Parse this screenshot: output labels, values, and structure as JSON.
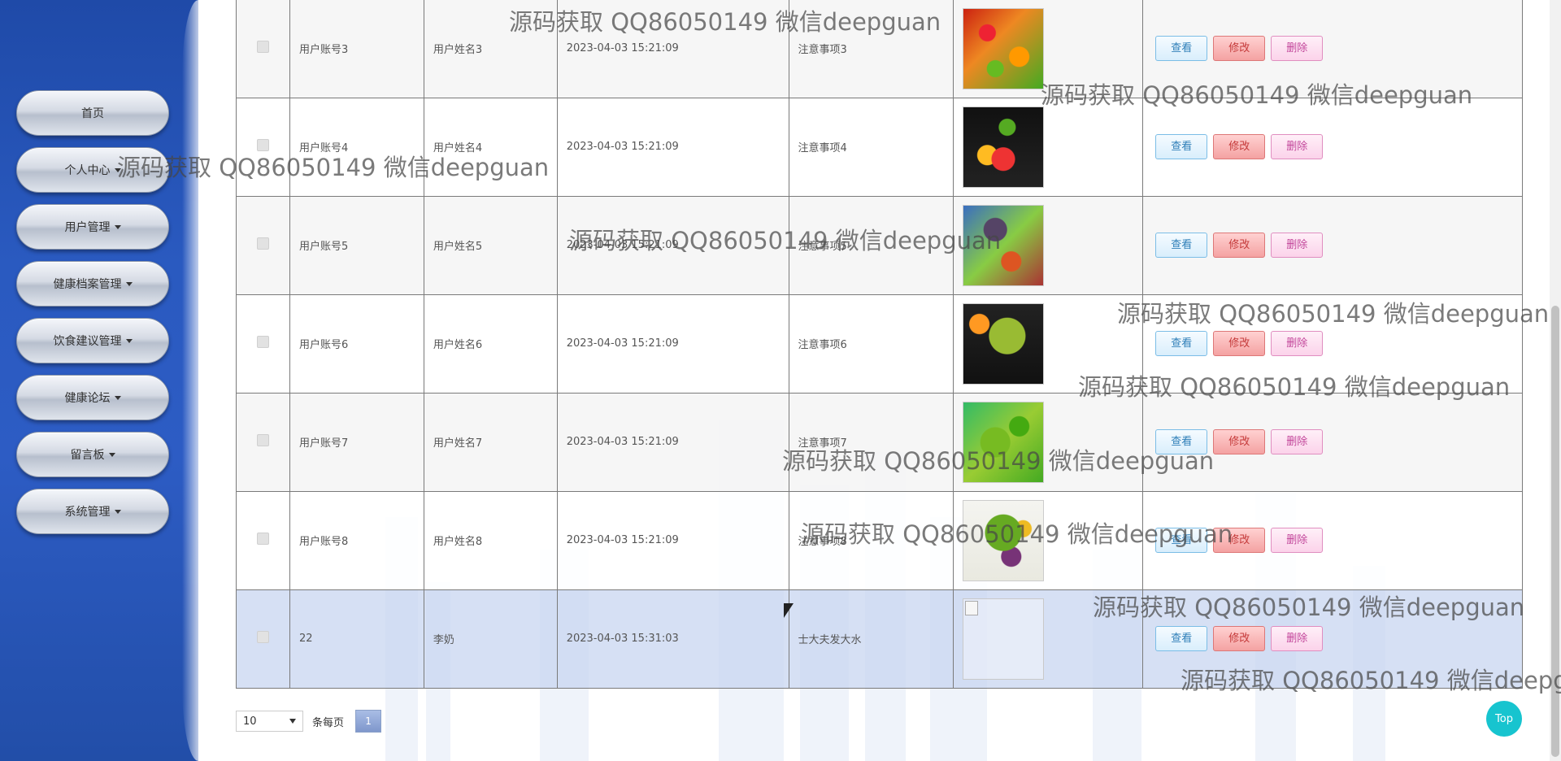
{
  "sidebar": {
    "items": [
      {
        "label": "首页",
        "has_dropdown": false
      },
      {
        "label": "个人中心",
        "has_dropdown": true
      },
      {
        "label": "用户管理",
        "has_dropdown": true
      },
      {
        "label": "健康档案管理",
        "has_dropdown": true
      },
      {
        "label": "饮食建议管理",
        "has_dropdown": true
      },
      {
        "label": "健康论坛",
        "has_dropdown": true
      },
      {
        "label": "留言板",
        "has_dropdown": true
      },
      {
        "label": "系统管理",
        "has_dropdown": true
      }
    ]
  },
  "table": {
    "rows": [
      {
        "account": "用户账号3",
        "name": "用户姓名3",
        "time": "2023-04-03 15:21:09",
        "note": "注意事项3",
        "image": "fruit-photo"
      },
      {
        "account": "用户账号4",
        "name": "用户姓名4",
        "time": "2023-04-03 15:21:09",
        "note": "注意事项4",
        "image": "fruit-basket-photo"
      },
      {
        "account": "用户账号5",
        "name": "用户姓名5",
        "time": "2023-04-03 15:21:09",
        "note": "注意事项5",
        "image": "fruit-vegetable-photo"
      },
      {
        "account": "用户账号6",
        "name": "用户姓名6",
        "time": "2023-04-03 15:21:09",
        "note": "注意事项6",
        "image": "green-juice-photo"
      },
      {
        "account": "用户账号7",
        "name": "用户姓名7",
        "time": "2023-04-03 15:21:09",
        "note": "注意事项7",
        "image": "vegetables-photo"
      },
      {
        "account": "用户账号8",
        "name": "用户姓名8",
        "time": "2023-04-03 15:21:09",
        "note": "注意事项8",
        "image": "salad-photo"
      },
      {
        "account": "22",
        "name": "李奶",
        "time": "2023-04-03 15:31:03",
        "note": "士大夫发大水",
        "image": "broken-image"
      }
    ],
    "actions": {
      "view": "查看",
      "edit": "修改",
      "delete": "删除"
    }
  },
  "pagination": {
    "page_size": "10",
    "per_page_label": "条每页",
    "current_page": "1"
  },
  "top_button": "Top",
  "watermark_text": "源码获取 QQ86050149 微信deepguan",
  "colors": {
    "sidebar": "#2a5ac0",
    "view_button": "#2f7fb8",
    "edit_button": "#c53a3a",
    "delete_button": "#c2459a",
    "top_button": "#17c4cf",
    "selected_row": "#c8d6f0"
  }
}
